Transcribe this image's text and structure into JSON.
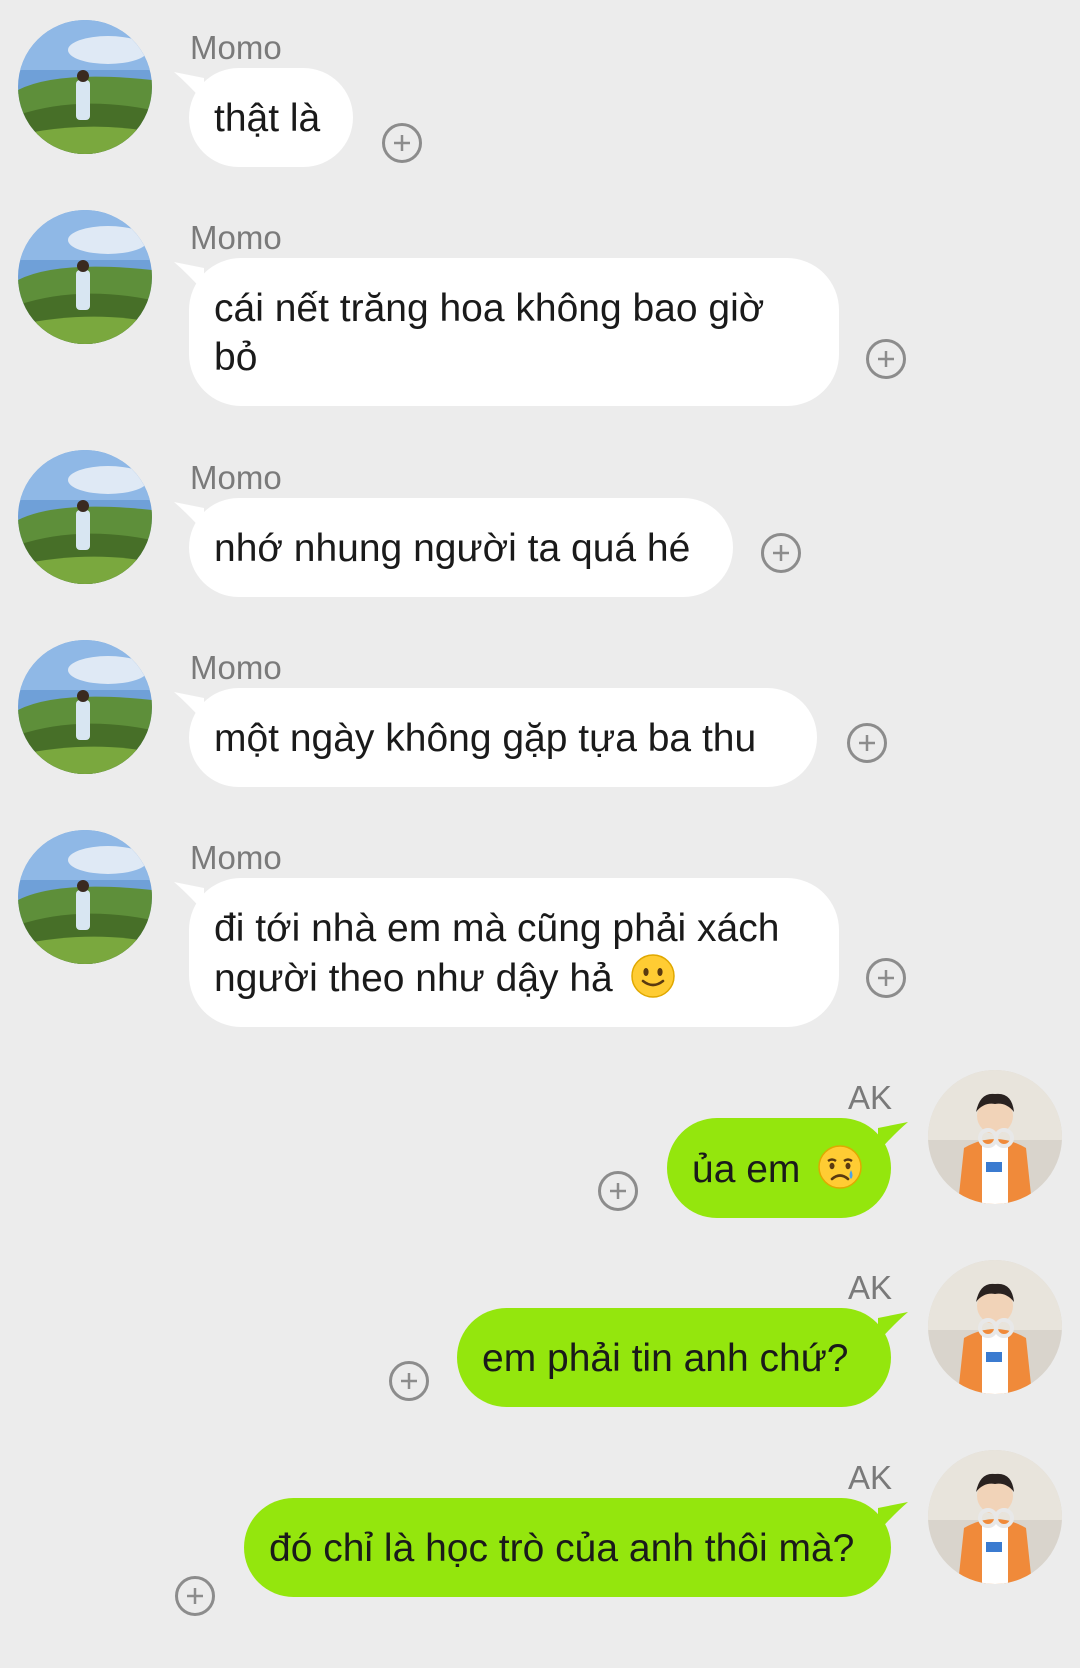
{
  "conversation": {
    "messages": [
      {
        "sender": "Momo",
        "side": "in",
        "text": "thật là",
        "emoji": ""
      },
      {
        "sender": "Momo",
        "side": "in",
        "text": "cái nết trăng hoa không bao giờ bỏ",
        "emoji": ""
      },
      {
        "sender": "Momo",
        "side": "in",
        "text": "nhớ nhung người ta quá hé",
        "emoji": ""
      },
      {
        "sender": "Momo",
        "side": "in",
        "text": "một ngày không gặp tựa ba thu",
        "emoji": ""
      },
      {
        "sender": "Momo",
        "side": "in",
        "text": "đi tới nhà em mà cũng phải xách người theo như dậy hả",
        "emoji": "slightly-smiling-face"
      },
      {
        "sender": "AK",
        "side": "out",
        "text": "ủa em",
        "emoji": "crying-face"
      },
      {
        "sender": "AK",
        "side": "out",
        "text": "em phải tin anh chứ?",
        "emoji": ""
      },
      {
        "sender": "AK",
        "side": "out",
        "text": "đó chỉ là học trò của anh thôi mà?",
        "emoji": ""
      }
    ]
  },
  "colors": {
    "background": "#ececec",
    "incoming_bubble": "#ffffff",
    "outgoing_bubble": "#94e60d",
    "sender_name": "#7a7a7a",
    "add_icon": "#8c8c8c"
  },
  "icons": {
    "add": "plus-circle-icon",
    "avatar_momo": "avatar-tea-field",
    "avatar_ak": "avatar-orange-jacket"
  }
}
